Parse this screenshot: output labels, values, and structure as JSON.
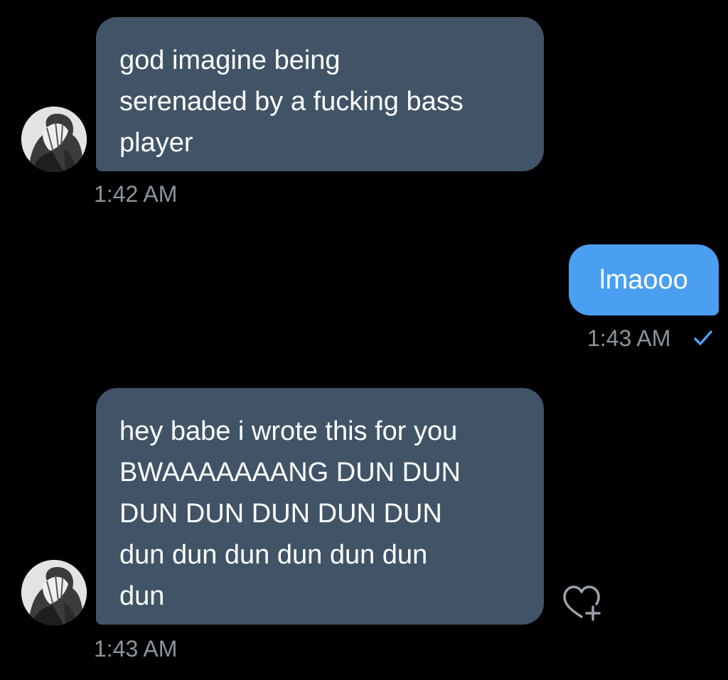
{
  "conversation": {
    "messages": [
      {
        "direction": "received",
        "text": "god imagine being\nserenaded by a fucking bass\nplayer",
        "timestamp": "1:42 AM"
      },
      {
        "direction": "sent",
        "text": "lmaooo",
        "timestamp": "1:43 AM",
        "status": "read"
      },
      {
        "direction": "received",
        "text": "hey babe i wrote this for you\nBWAAAAAAANG DUN DUN\nDUN DUN DUN DUN DUN\ndun dun dun dun dun dun\ndun",
        "timestamp": "1:43 AM"
      }
    ],
    "icons": {
      "read_receipt": "checkmark-icon",
      "add_reaction": "heart-plus-icon",
      "avatar": "avatar"
    },
    "colors": {
      "background": "#000000",
      "received_bubble": "#415467",
      "sent_bubble": "#4a9ff0",
      "timestamp": "#8a949c",
      "checkmark": "#4a9ff0"
    }
  }
}
